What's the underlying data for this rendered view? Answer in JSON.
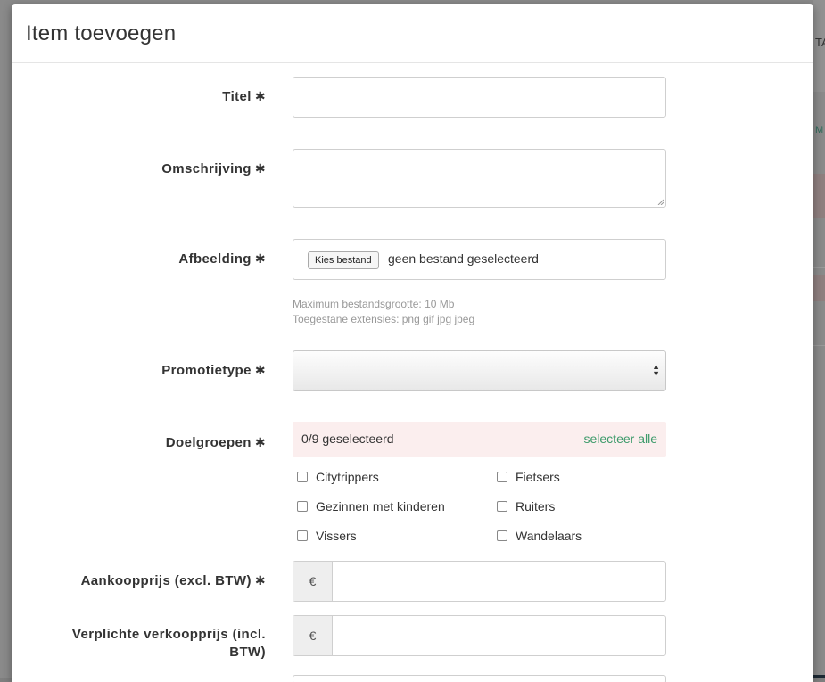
{
  "background": {
    "edge_text_1": "TA",
    "edge_text_2": "M"
  },
  "modal": {
    "title": "Item toevoegen",
    "required_mark": "✱",
    "fields": {
      "titel": {
        "label": "Titel",
        "value": ""
      },
      "omschrijving": {
        "label": "Omschrijving",
        "value": ""
      },
      "afbeelding": {
        "label": "Afbeelding",
        "button": "Kies bestand",
        "status": "geen bestand geselecteerd",
        "help_size": "Maximum bestandsgrootte: 10 Mb",
        "help_ext": "Toegestane extensies: png gif jpg jpeg"
      },
      "promotietype": {
        "label": "Promotietype",
        "selected": ""
      },
      "doelgroepen": {
        "label": "Doelgroepen",
        "count": "0/9 geselecteerd",
        "select_all": "selecteer alle",
        "options": [
          "Citytrippers",
          "Fietsers",
          "Gezinnen met kinderen",
          "Ruiters",
          "Vissers",
          "Wandelaars"
        ]
      },
      "aankoopprijs": {
        "label_line1": "Aankoopprijs (excl. BTW)",
        "addon": "€",
        "value": ""
      },
      "verkoopprijs": {
        "label_line1": "Verplichte verkoopprijs (incl.",
        "label_line2": "BTW)",
        "addon": "€",
        "value": ""
      }
    }
  },
  "colors": {
    "accent_green": "#3c9a6a",
    "alert_bg": "#fbeeee",
    "backdrop": "#7f7f7f"
  }
}
